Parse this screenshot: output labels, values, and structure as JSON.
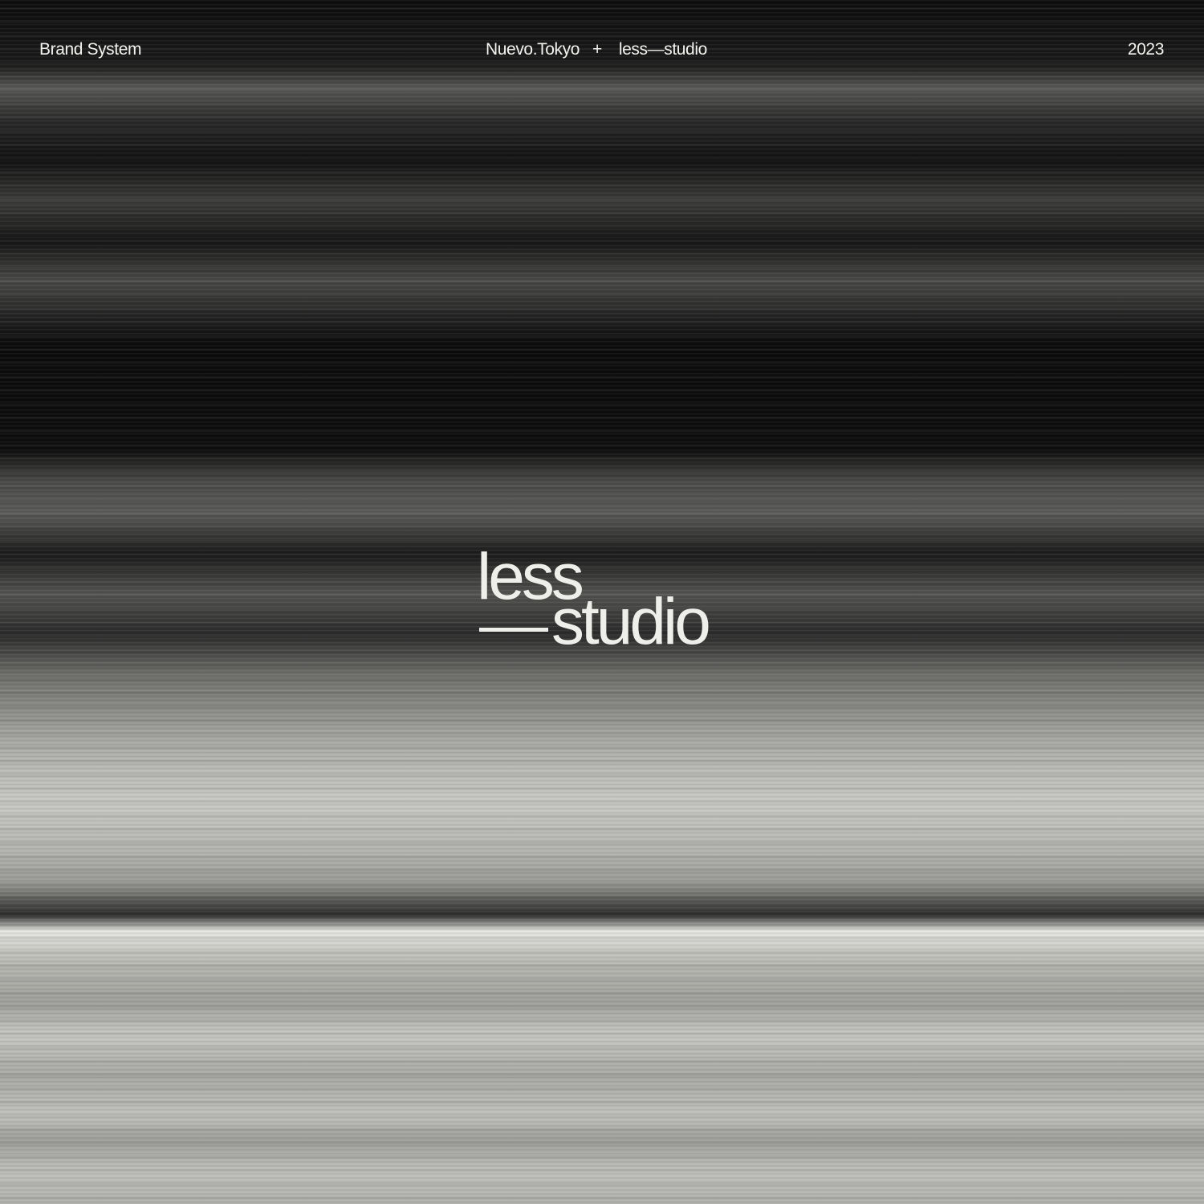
{
  "header": {
    "left": "Brand System",
    "center_left": "Nuevo.Tokyo",
    "center_separator": "+",
    "center_right": "less—studio",
    "right": "2023"
  },
  "logo": {
    "line1": "less",
    "line2": "studio"
  },
  "colors": {
    "text": "#f2f2ee",
    "background_dark": "#0c0c0c",
    "background_light": "#c8c8c4"
  }
}
